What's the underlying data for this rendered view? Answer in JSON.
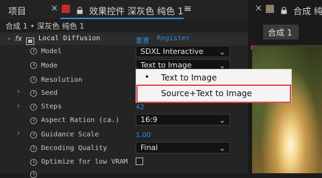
{
  "tabs": {
    "project_label": "项目",
    "effect_controls_label": "效果控件 深灰色 纯色 1",
    "right_tab_label": "合成 纯",
    "menu_glyph": "≡",
    "close_glyph": "×"
  },
  "breadcrumb": "合成 1 • 深灰色 纯色 1",
  "effect": {
    "fx": "fx",
    "name": "Local Diffusion",
    "reset_label": "重置",
    "register_label": "Register"
  },
  "properties": {
    "model": {
      "label": "Model",
      "value": "SDXL Interactive"
    },
    "mode": {
      "label": "Mode",
      "value": "Text to Image"
    },
    "resolution": {
      "label": "Resolution"
    },
    "seed": {
      "label": "Seed"
    },
    "steps": {
      "label": "Steps",
      "value": "42"
    },
    "aspect": {
      "label": "Aspect Ration (ca.)",
      "value": "16:9"
    },
    "guidance": {
      "label": "Guidance Scale",
      "value": "1.00"
    },
    "decoding": {
      "label": "Decoding Quality",
      "value": "Final"
    },
    "optimize": {
      "label": "Optimize for low VRAM",
      "checked": false
    }
  },
  "popup": {
    "items": [
      {
        "label": "Text to Image",
        "selected": true,
        "bullet": "•"
      },
      {
        "label": "Source+Text to Image",
        "selected": false,
        "bullet": ""
      }
    ]
  },
  "comp_panel": {
    "tab_label": "合成 1"
  },
  "colors": {
    "accent_blue": "#2f8ae3",
    "highlight_red": "#e04848",
    "layer_red": "#c62b2b"
  }
}
